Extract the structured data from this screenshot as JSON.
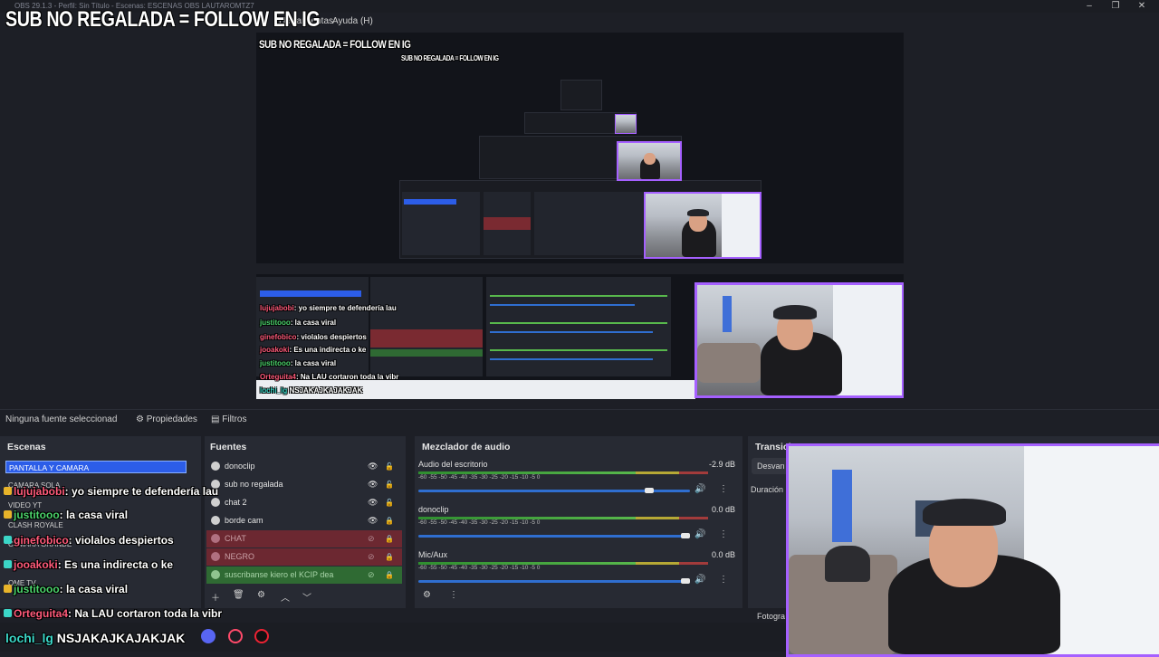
{
  "overlay": {
    "banner": "SUB NO REGALADA = FOLLOW EN IG"
  },
  "window": {
    "title": "OBS 29.1.3 - Perfil: Sin Título - Escenas: ESCENAS OBS LAUTAROMTZ7",
    "menu": [
      "Herramientas",
      "Ayuda (H)"
    ]
  },
  "colors": {
    "accent": "#2c5de8",
    "overlay_border": "#a560ff",
    "chat_name": "#ff5a7a"
  },
  "status": {
    "no_source": "Ninguna fuente seleccionad",
    "properties": "Propiedades",
    "filters": "Filtros"
  },
  "scenes": {
    "header": "Escenas",
    "selected": "PANTALLA Y CAMARA",
    "items": [
      "CAMARA SOLA",
      "VIDEO YT",
      "CLASH ROYALE",
      "CAMARA GRANDE",
      "OME TV"
    ]
  },
  "sources": {
    "header": "Fuentes",
    "items": [
      {
        "label": "donoclip",
        "state": "visible"
      },
      {
        "label": "sub no regalada",
        "state": "visible"
      },
      {
        "label": "chat 2",
        "state": "visible"
      },
      {
        "label": "borde cam",
        "state": "visible"
      },
      {
        "label": "CHAT",
        "state": "hidden"
      },
      {
        "label": "NEGRO",
        "state": "hidden"
      },
      {
        "label": "suscribanse kiero el KCIP dea",
        "state": "hidden"
      }
    ]
  },
  "mixer": {
    "header": "Mezclador de audio",
    "scale": "-60 -55 -50 -45 -40 -35 -30 -25 -20 -15 -10 -5 0",
    "channels": [
      {
        "label": "Audio del escritorio",
        "db": "-2.9 dB",
        "level": 0.86
      },
      {
        "label": "donoclip",
        "db": "0.0 dB",
        "level": 1.0
      },
      {
        "label": "Mic/Aux",
        "db": "0.0 dB",
        "level": 1.0
      }
    ]
  },
  "transitions": {
    "header": "Transiciones",
    "fade": "Desvan",
    "duration": "Duración",
    "studio": "Fotogra"
  },
  "chat": [
    {
      "user": "lujujabobi",
      "text": "yo siempre te defendería lau",
      "color": "#ff5a7a"
    },
    {
      "user": "justitooo",
      "text": "la casa viral",
      "color": "#4bd36b"
    },
    {
      "user": "ginefobico",
      "text": "violalos despiertos",
      "color": "#ff5a7a"
    },
    {
      "user": "jooakoki",
      "text": "Es una indirecta o ke",
      "color": "#ff5a7a"
    },
    {
      "user": "justitooo",
      "text": "la casa viral",
      "color": "#4bd36b"
    },
    {
      "user": "Orteguita4",
      "text": "Na LAU cortaron toda la vibr",
      "color": "#ff5a7a"
    }
  ],
  "footer": {
    "handle_user": "lochi_lg",
    "handle_text": "NSJAKAJKAJAKJAK"
  }
}
